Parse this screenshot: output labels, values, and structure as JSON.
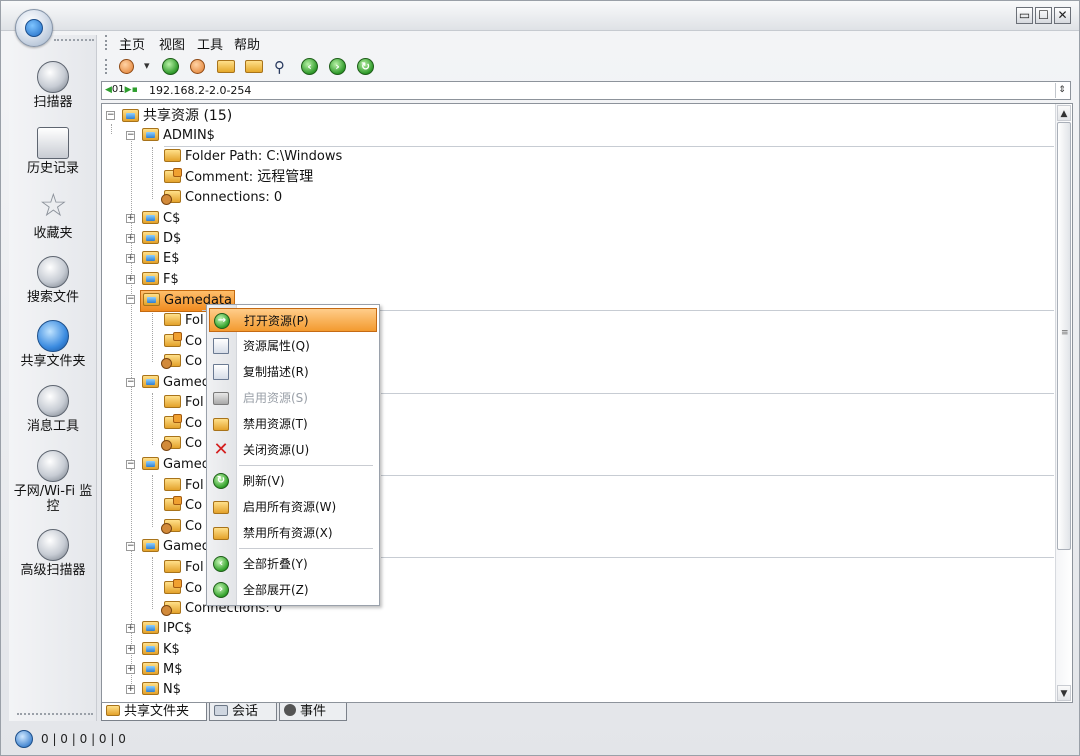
{
  "window": {
    "controls": [
      "▭",
      "☐",
      "✕"
    ]
  },
  "sidebar": {
    "items": [
      {
        "label": "扫描器",
        "icon": "scanner-icon"
      },
      {
        "label": "历史记录",
        "icon": "history-icon"
      },
      {
        "label": "收藏夹",
        "icon": "favorites-star-icon"
      },
      {
        "label": "搜索文件",
        "icon": "search-files-icon"
      },
      {
        "label": "共享文件夹",
        "icon": "shared-folder-icon"
      },
      {
        "label": "消息工具",
        "icon": "message-tool-icon"
      },
      {
        "label": "子网/Wi-Fi 监控",
        "icon": "subnet-monitor-icon"
      },
      {
        "label": "高级扫描器",
        "icon": "advanced-scanner-icon"
      }
    ]
  },
  "menubar": {
    "items": [
      "主页",
      "视图",
      "工具",
      "帮助"
    ]
  },
  "toolbar": {
    "buttons": [
      "scan-icon",
      "refresh-icon",
      "users-icon",
      "open-folder-icon",
      "share-folder-icon",
      "search-icon",
      "back-icon",
      "forward-icon",
      "reload-icon"
    ],
    "dropdown_arrow": "▾"
  },
  "address": {
    "indicator": "01",
    "value": "192.168.2-2.0-254"
  },
  "tree": {
    "root_label": "共享资源 (15)",
    "admin": {
      "name": "ADMIN$",
      "folder_path": "Folder Path: C:\\Windows",
      "comment_prefix": "Comment: ",
      "comment": "远程管理",
      "connections": "Connections: 0"
    },
    "collapsed_top": [
      "C$",
      "D$",
      "E$",
      "F$"
    ],
    "gamedata_selected": "Gamedata",
    "gamedata_children": [
      "Fol",
      "Co",
      "Co"
    ],
    "gamed_groups": [
      {
        "name": "Gamed",
        "children": [
          "Fol",
          "Co",
          "Co"
        ]
      },
      {
        "name": "Gamed",
        "children": [
          "Fol",
          "Co",
          "Co"
        ]
      },
      {
        "name": "Gamed",
        "children": [
          "Fol",
          "Co"
        ]
      }
    ],
    "last_connections": "Connections: 0",
    "collapsed_bottom": [
      "IPC$",
      "K$",
      "M$",
      "N$"
    ]
  },
  "context_menu": {
    "items": [
      {
        "label": "打开资源(P)",
        "icon": "open-resource-icon",
        "state": "highlighted"
      },
      {
        "label": "资源属性(Q)",
        "icon": "properties-icon",
        "state": "normal"
      },
      {
        "label": "复制描述(R)",
        "icon": "copy-icon",
        "state": "normal"
      },
      {
        "label": "启用资源(S)",
        "icon": "enable-resource-icon",
        "state": "disabled"
      },
      {
        "label": "禁用资源(T)",
        "icon": "disable-resource-icon",
        "state": "normal"
      },
      {
        "label": "关闭资源(U)",
        "icon": "close-resource-icon",
        "state": "normal"
      },
      {
        "label": "刷新(V)",
        "icon": "refresh-icon",
        "state": "normal"
      },
      {
        "label": "启用所有资源(W)",
        "icon": "enable-all-icon",
        "state": "normal"
      },
      {
        "label": "禁用所有资源(X)",
        "icon": "disable-all-icon",
        "state": "normal"
      },
      {
        "label": "全部折叠(Y)",
        "icon": "collapse-all-icon",
        "state": "normal"
      },
      {
        "label": "全部展开(Z)",
        "icon": "expand-all-icon",
        "state": "normal"
      }
    ]
  },
  "bottom_tabs": [
    "共享文件夹",
    "会话",
    "事件"
  ],
  "status": {
    "text": "0 | 0 | 0 | 0 | 0"
  }
}
